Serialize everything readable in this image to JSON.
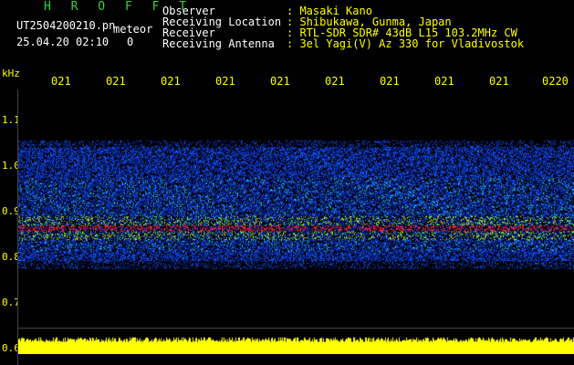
{
  "header": {
    "title": "H R O F F T",
    "filename": "UT2504200210.pn",
    "meteor_label": "meteor",
    "datetime": "25.04.20 02:10",
    "count": "0"
  },
  "info": [
    {
      "label": "Observer",
      "value": ": Masaki Kano"
    },
    {
      "label": "Receiving Location",
      "value": ": Shibukawa, Gunma, Japan"
    },
    {
      "label": "Receiver",
      "value": ": RTL-SDR SDR# 43dB L15 103.2MHz CW"
    },
    {
      "label": "Receiving Antenna",
      "value": ": 3el Yagi(V) Az 330 for Vladivostok"
    }
  ],
  "axis": {
    "unit": "kHz",
    "y_ticks": [
      "1.1",
      "1.0",
      "0.9",
      "0.8",
      "0.7",
      "0.6"
    ],
    "time_ticks": [
      "021",
      "021",
      "021",
      "021",
      "021",
      "021",
      "021",
      "021",
      "021",
      "0220"
    ]
  },
  "colors": {
    "background": "#000000",
    "header_green": "#3ecf3e",
    "label_yellow": "#ffff00",
    "signal_red": "#ff2020",
    "noise_blue": "#1040ff"
  }
}
